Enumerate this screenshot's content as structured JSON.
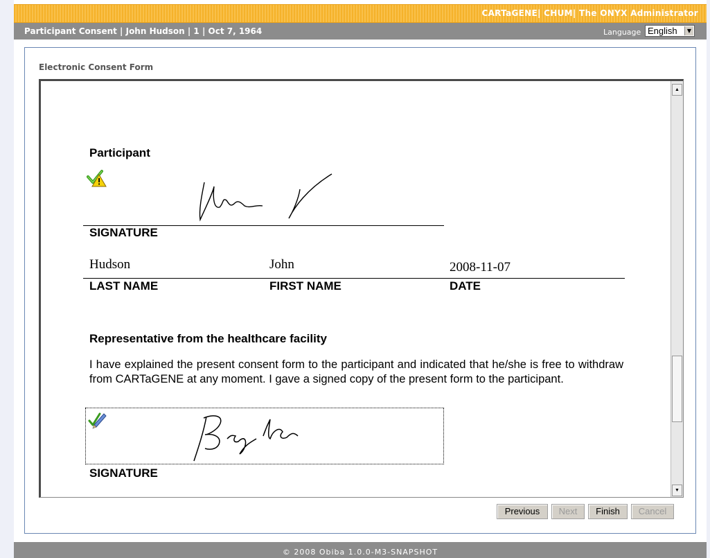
{
  "app": {
    "title": "CARTaGENE| CHUM| The ONYX Administrator"
  },
  "header": {
    "title": "Participant Consent | John Hudson | 1 | Oct 7, 1964",
    "language_label": "Language",
    "language_value": "English"
  },
  "panel": {
    "title": "Electronic Consent Form"
  },
  "form": {
    "participant_heading": "Participant",
    "signature_label": "SIGNATURE",
    "last_name_value": "Hudson",
    "first_name_value": "John",
    "date_value": "2008-11-07",
    "last_name_label": "LAST NAME",
    "first_name_label": "FIRST NAME",
    "date_label": "DATE",
    "representative_heading": "Representative from the healthcare facility",
    "representative_text": "I have explained the present consent form to the participant and indicated that he/she is free to withdraw from CARTaGENE at any moment. I gave a signed copy of the present form to the participant.",
    "signature_label_2": "SIGNATURE"
  },
  "buttons": {
    "previous": "Previous",
    "next": "Next",
    "finish": "Finish",
    "cancel": "Cancel"
  },
  "footer": {
    "text": "© 2008 Obiba 1.0.0-M3-SNAPSHOT"
  },
  "icons": {
    "signed_warning": "check-warning-icon",
    "edit_signature": "pen-edit-icon"
  },
  "colors": {
    "topbar": "#f5b22a",
    "headerbar": "#8c8c8c",
    "panel_border": "#6a87b3"
  }
}
